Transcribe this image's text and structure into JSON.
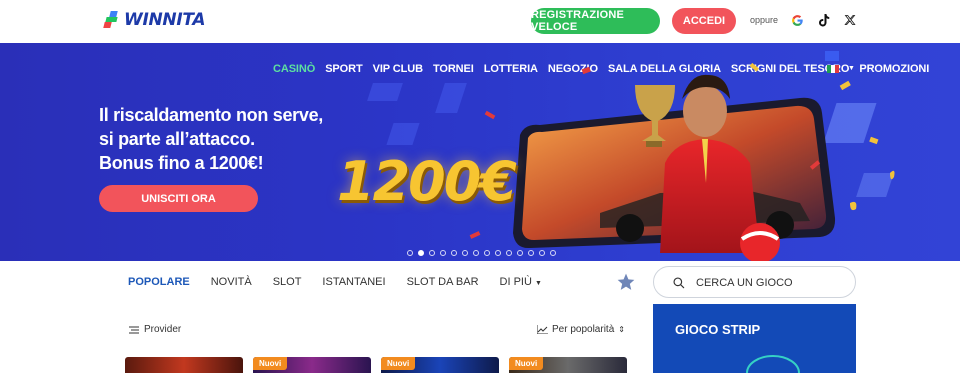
{
  "header": {
    "logo_text": "WINNITA",
    "register_label": "REGISTRAZIONE VELOCE",
    "login_label": "ACCEDI",
    "or_label": "oppure",
    "social_icons": [
      "google-icon",
      "tiktok-icon",
      "x-icon"
    ]
  },
  "nav": {
    "items": [
      {
        "label": "CASINÒ",
        "active": true
      },
      {
        "label": "SPORT"
      },
      {
        "label": "VIP CLUB"
      },
      {
        "label": "TORNEI"
      },
      {
        "label": "LOTTERIA"
      },
      {
        "label": "NEGOZIO"
      },
      {
        "label": "SALA DELLA GLORIA"
      },
      {
        "label": "SCRIGNI DEL TESORO"
      },
      {
        "label": "PROMOZIONI"
      }
    ],
    "language_icon": "italy-flag-icon"
  },
  "hero": {
    "title_line1": "Il riscaldamento non serve,",
    "title_line2": "si parte all’attacco.",
    "title_line3": "Bonus fino a 1200€!",
    "cta_label": "UNISCITI ORA",
    "amount_text": "1200€",
    "slide_count": 14,
    "active_slide": 2
  },
  "categories": {
    "tabs": [
      {
        "label": "POPOLARE",
        "active": true
      },
      {
        "label": "NOVITÀ"
      },
      {
        "label": "SLOT"
      },
      {
        "label": "ISTANTANEI"
      },
      {
        "label": "SLOT DA BAR"
      },
      {
        "label": "DI PIÙ"
      }
    ],
    "search_placeholder": "CERCA UN GIOCO"
  },
  "controls": {
    "provider_label": "Provider",
    "sort_label": "Per popolarità"
  },
  "games": {
    "cards": [
      {
        "badge": ""
      },
      {
        "badge": "Nuovi"
      },
      {
        "badge": "Nuovi"
      },
      {
        "badge": "Nuovi"
      }
    ]
  },
  "sidebar": {
    "strip_title": "GIOCO STRIP"
  },
  "colors": {
    "brand_blue": "#1d3aa8",
    "register_green": "#2ebd59",
    "accent_red": "#f2545b",
    "active_nav_green": "#5de0a0",
    "hero_blue": "#2b35c7",
    "new_badge_orange": "#f28b1f"
  }
}
